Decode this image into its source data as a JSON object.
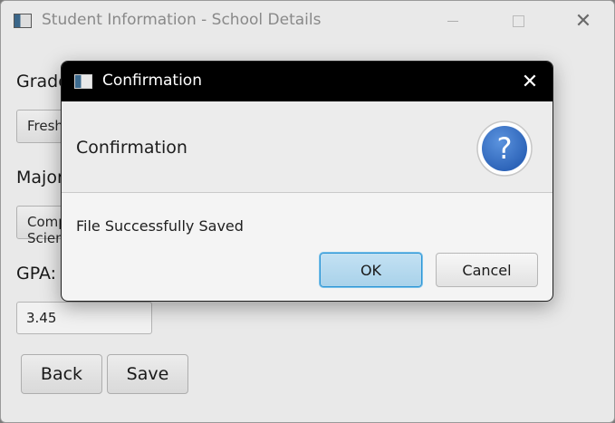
{
  "window": {
    "title": "Student Information - School Details",
    "minimize_icon": "minimize-icon",
    "maximize_icon": "maximize-icon",
    "close_glyph": "✕"
  },
  "form": {
    "grade_label": "Grade:",
    "grade_value": "Freshman",
    "major_label": "Major:",
    "major_value": "Computer Science",
    "gpa_label": "GPA:",
    "gpa_value": "3.45",
    "back_label": "Back",
    "save_label": "Save"
  },
  "dialog": {
    "title": "Confirmation",
    "close_glyph": "✕",
    "header_text": "Confirmation",
    "icon": "question-icon",
    "message": "File Successfully Saved",
    "ok_label": "OK",
    "cancel_label": "Cancel",
    "accent_color": "#2f6fc4"
  }
}
